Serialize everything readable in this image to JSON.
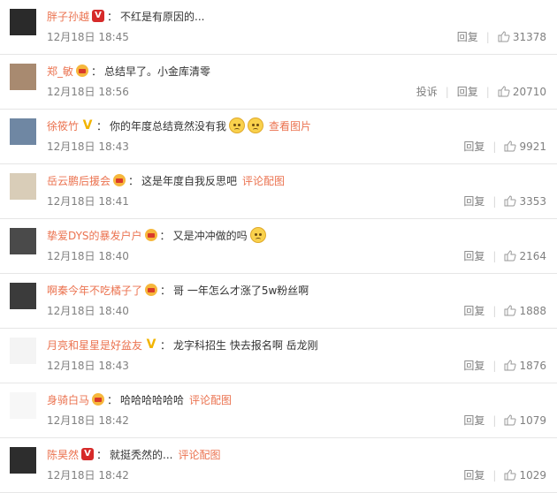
{
  "comments": [
    {
      "name": "胖子孙越",
      "badge": "v",
      "text": "不红是有原因的...",
      "emojis": 0,
      "link": "",
      "time": "12月18日 18:45",
      "report": "",
      "reply": "回复",
      "likes": "31378",
      "avatar_color": "#2a2a2a"
    },
    {
      "name": "郑_敏",
      "badge": "crown",
      "text": "总结早了。小金库清零",
      "emojis": 0,
      "link": "",
      "time": "12月18日 18:56",
      "report": "投诉",
      "reply": "回复",
      "likes": "20710",
      "avatar_color": "#a88a70"
    },
    {
      "name": "徐筱竹",
      "badge": "vy",
      "text": "你的年度总结竟然没有我",
      "emojis": 2,
      "link": "查看图片",
      "time": "12月18日 18:43",
      "report": "",
      "reply": "回复",
      "likes": "9921",
      "avatar_color": "#6f87a3"
    },
    {
      "name": "岳云鹏后援会",
      "badge": "crown",
      "text": "这是年度自我反思吧",
      "emojis": 0,
      "link": "评论配图",
      "time": "12月18日 18:41",
      "report": "",
      "reply": "回复",
      "likes": "3353",
      "avatar_color": "#d9cdb8"
    },
    {
      "name": "挚爱DYS的暴发户户",
      "badge": "crown",
      "text": "又是冲冲做的吗",
      "emojis": 1,
      "link": "",
      "time": "12月18日 18:40",
      "report": "",
      "reply": "回复",
      "likes": "2164",
      "avatar_color": "#4a4a4a"
    },
    {
      "name": "啊秦今年不吃橘子了",
      "badge": "crown",
      "text": "哥 一年怎么才涨了5w粉丝啊",
      "emojis": 0,
      "link": "",
      "time": "12月18日 18:40",
      "report": "",
      "reply": "回复",
      "likes": "1888",
      "avatar_color": "#3b3b3b"
    },
    {
      "name": "月亮和星星是好盆友",
      "badge": "vy",
      "text": "龙字科招生 快去报名啊 岳龙刚",
      "emojis": 0,
      "link": "",
      "time": "12月18日 18:43",
      "report": "",
      "reply": "回复",
      "likes": "1876",
      "avatar_color": "#f4f4f4"
    },
    {
      "name": "身骑白马",
      "badge": "crown",
      "text": "哈哈哈哈哈哈",
      "emojis": 0,
      "link": "评论配图",
      "time": "12月18日 18:42",
      "report": "",
      "reply": "回复",
      "likes": "1079",
      "avatar_color": "#f7f7f7"
    },
    {
      "name": "陈昊然",
      "badge": "v",
      "text": "就挺秃然的...",
      "emojis": 0,
      "link": "评论配图",
      "time": "12月18日 18:42",
      "report": "",
      "reply": "回复",
      "likes": "1029",
      "avatar_color": "#2d2d2d"
    }
  ],
  "separator": "：",
  "colors": {
    "link": "#eb7350",
    "meta": "#808080",
    "divider": "#e6e6e6"
  }
}
